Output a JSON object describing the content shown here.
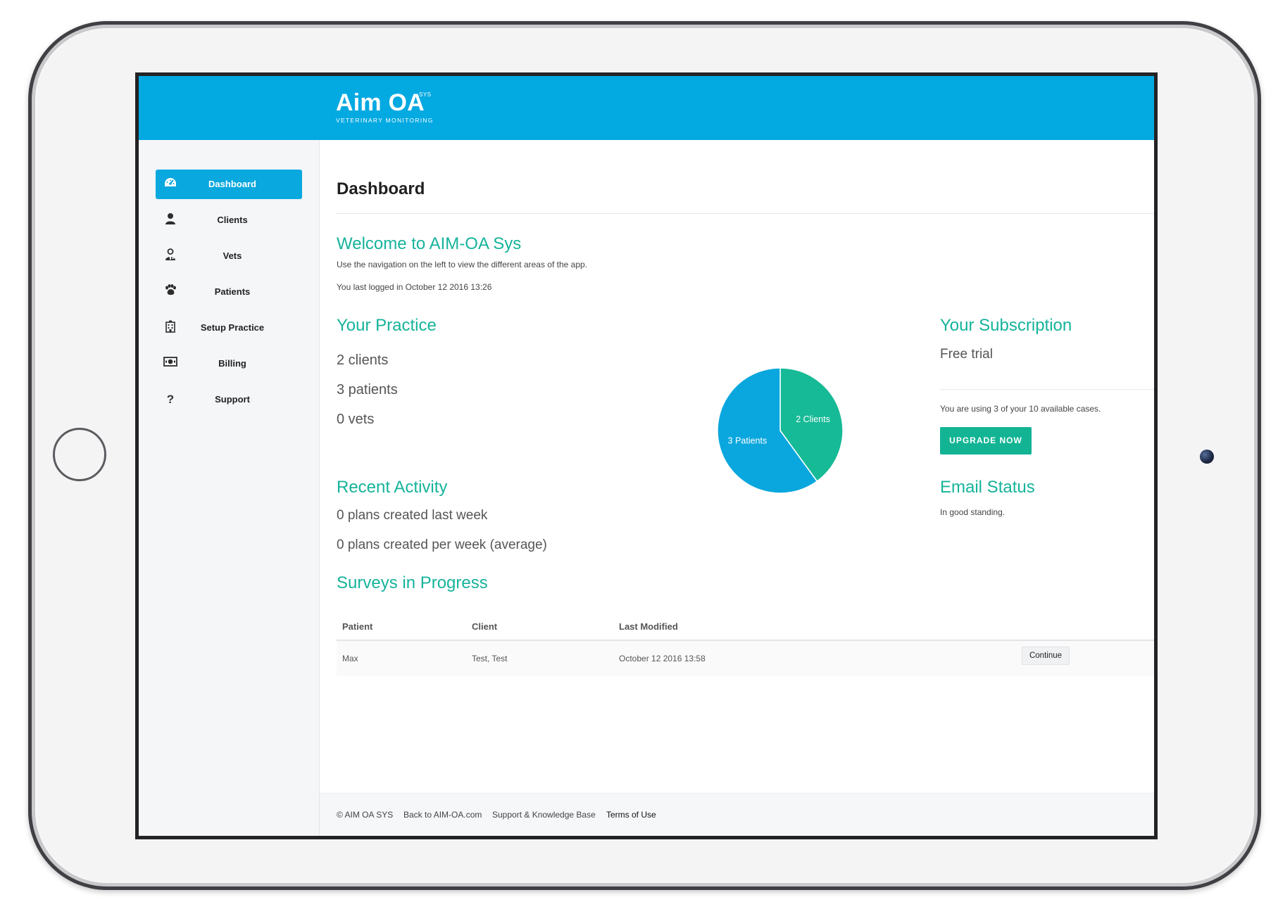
{
  "brand": {
    "name": "Aim OA",
    "superscript": "SYS",
    "tagline": "VETERINARY MONITORING"
  },
  "sidebar": {
    "items": [
      {
        "label": "Dashboard",
        "icon": "dashboard-gauge-icon",
        "active": true
      },
      {
        "label": "Clients",
        "icon": "user-icon",
        "active": false
      },
      {
        "label": "Vets",
        "icon": "doctor-icon",
        "active": false
      },
      {
        "label": "Patients",
        "icon": "paw-icon",
        "active": false
      },
      {
        "label": "Setup Practice",
        "icon": "building-icon",
        "active": false
      },
      {
        "label": "Billing",
        "icon": "money-icon",
        "active": false
      },
      {
        "label": "Support",
        "icon": "question-icon",
        "active": false
      }
    ]
  },
  "main": {
    "page_title": "Dashboard",
    "welcome": {
      "heading": "Welcome to AIM-OA Sys",
      "intro": "Use the navigation on the left to view the different areas of the app.",
      "last_login": "You last logged in October 12 2016 13:26"
    },
    "practice": {
      "heading": "Your Practice",
      "clients": "2 clients",
      "patients": "3 patients",
      "vets": "0 vets"
    },
    "subscription": {
      "heading": "Your Subscription",
      "plan": "Free trial",
      "usage": "You are using 3 of your 10 available cases.",
      "upgrade_label": "UPGRADE NOW"
    },
    "activity": {
      "heading": "Recent Activity",
      "last_week": "0 plans created last week",
      "per_week": "0 plans created per week (average)"
    },
    "email": {
      "heading": "Email Status",
      "status": "In good standing."
    },
    "surveys": {
      "heading": "Surveys in Progress",
      "columns": [
        "Patient",
        "Client",
        "Last Modified"
      ],
      "rows": [
        {
          "patient": "Max",
          "client": "Test, Test",
          "modified": "October 12 2016 13:58",
          "action": "Continue"
        }
      ]
    }
  },
  "chart_data": {
    "type": "pie",
    "categories": [
      "2 Clients",
      "3 Patients"
    ],
    "values": [
      2,
      3
    ],
    "colors": [
      "#16ba96",
      "#0aa7de"
    ],
    "start_angle_deg": 0,
    "direction": "clockwise"
  },
  "footer": {
    "copyright": "© AIM OA SYS",
    "links": [
      "Back to AIM-OA.com",
      "Support & Knowledge Base",
      "Terms of Use"
    ]
  },
  "colors": {
    "header_blue": "#03a9e1",
    "accent_teal": "#16b39b",
    "button_teal": "#12b494"
  }
}
